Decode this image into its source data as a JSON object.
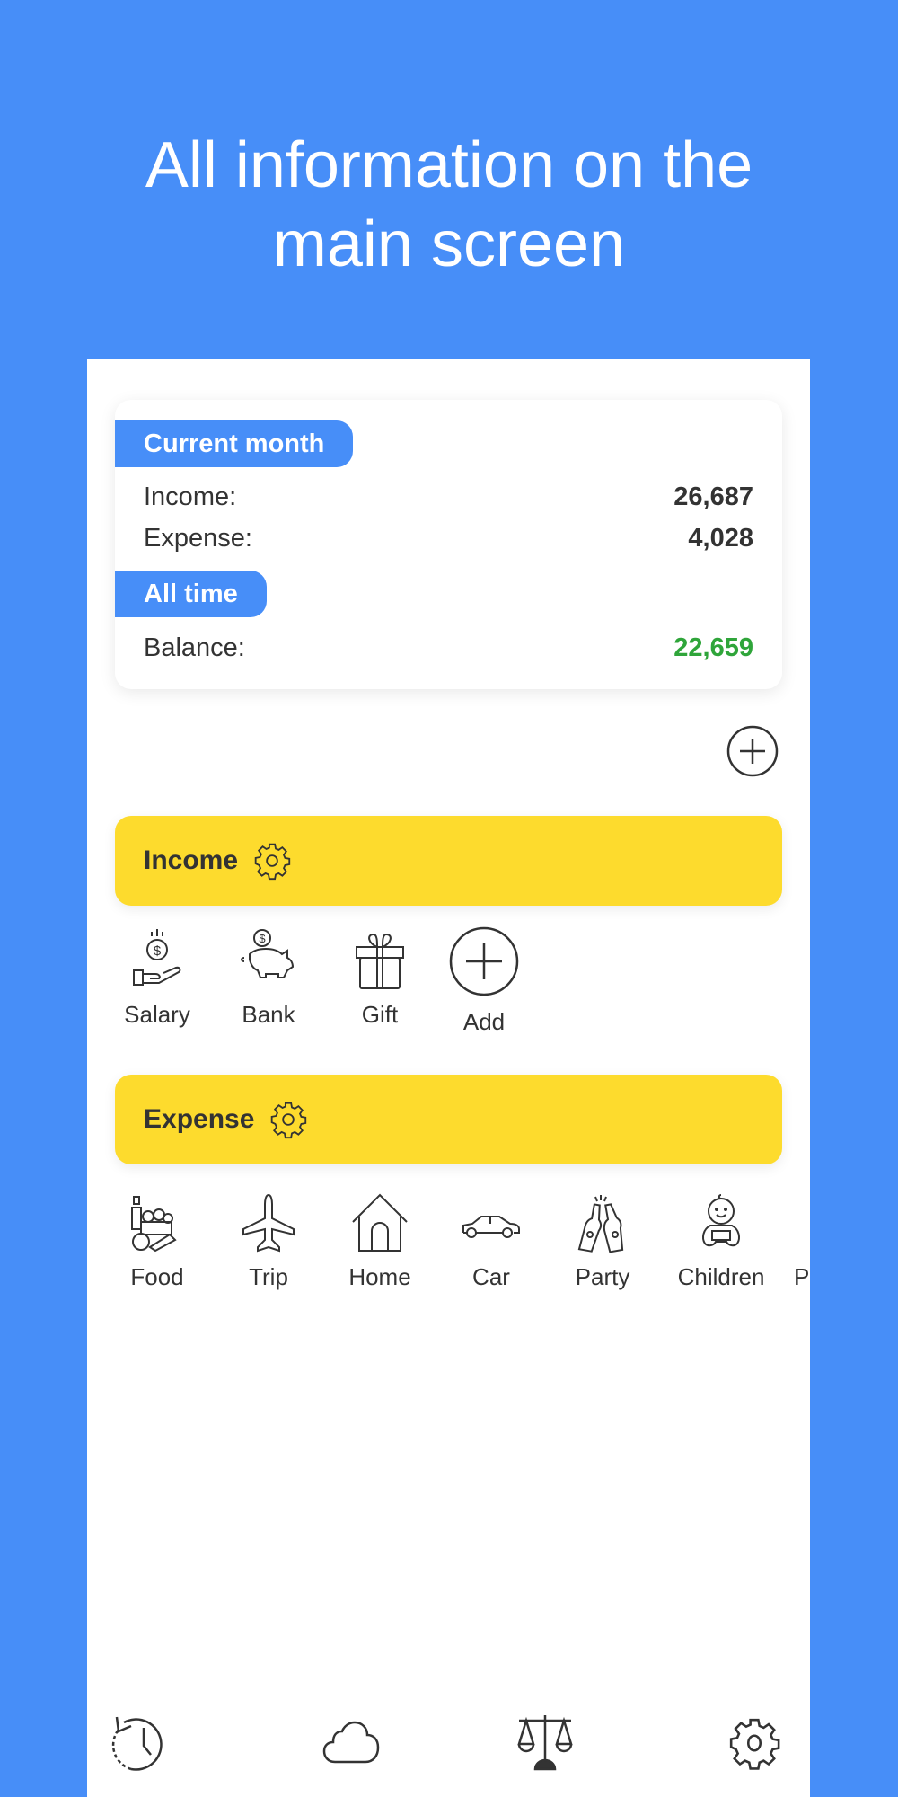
{
  "headline": {
    "line1": "All information on the",
    "line2": "main screen"
  },
  "summary": {
    "current_month_label": "Current month",
    "income_label": "Income:",
    "income_value": "26,687",
    "expense_label": "Expense:",
    "expense_value": "4,028",
    "all_time_label": "All time",
    "balance_label": "Balance:",
    "balance_value": "22,659"
  },
  "income_section": {
    "title": "Income",
    "categories": [
      {
        "label": "Salary",
        "icon": "salary-icon"
      },
      {
        "label": "Bank",
        "icon": "piggy-bank-icon"
      },
      {
        "label": "Gift",
        "icon": "gift-icon"
      },
      {
        "label": "Add",
        "icon": "plus-circle-icon"
      }
    ]
  },
  "expense_section": {
    "title": "Expense",
    "categories": [
      {
        "label": "Food",
        "icon": "groceries-icon"
      },
      {
        "label": "Trip",
        "icon": "airplane-icon"
      },
      {
        "label": "Home",
        "icon": "house-icon"
      },
      {
        "label": "Car",
        "icon": "car-icon"
      },
      {
        "label": "Party",
        "icon": "beer-bottles-icon"
      },
      {
        "label": "Children",
        "icon": "baby-icon"
      },
      {
        "label": "P",
        "icon": ""
      }
    ]
  },
  "tabbar": [
    {
      "name": "history",
      "icon": "history-icon"
    },
    {
      "name": "cloud",
      "icon": "cloud-icon"
    },
    {
      "name": "balance",
      "icon": "scales-icon"
    },
    {
      "name": "settings",
      "icon": "gear-icon"
    }
  ],
  "colors": {
    "brand_blue": "#478ef8",
    "section_yellow": "#fddb2d",
    "positive_green": "#2fa53a",
    "text_dark": "#333333"
  }
}
